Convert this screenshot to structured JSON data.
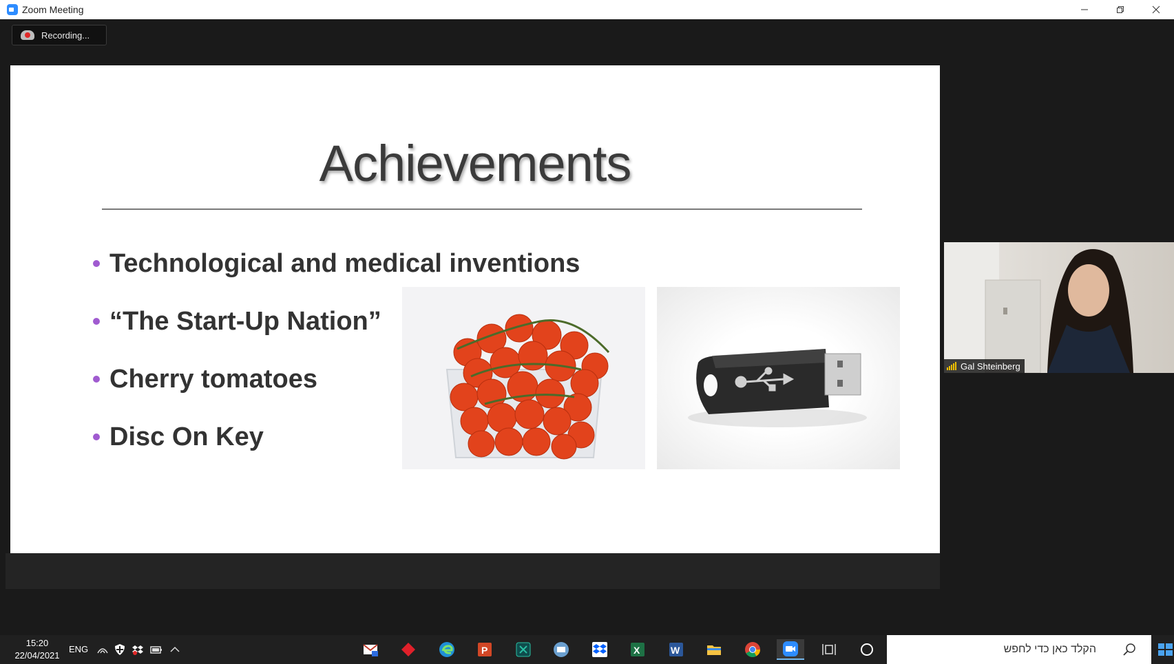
{
  "window": {
    "title": "Zoom Meeting"
  },
  "recording": {
    "label": "Recording..."
  },
  "slide": {
    "title": "Achievements",
    "bullets": [
      "Technological and medical inventions",
      "“The Start-Up Nation”",
      "Cherry tomatoes",
      "Disc On Key"
    ]
  },
  "participant": {
    "name": "Gal Shteinberg"
  },
  "taskbar": {
    "time": "15:20",
    "date": "22/04/2021",
    "language": "ENG",
    "search_placeholder": "הקלד כאן כדי לחפש",
    "apps": [
      "mail-icon",
      "antivirus-icon",
      "edge-icon",
      "powerpoint-icon",
      "app-icon",
      "tv-icon",
      "dropbox-icon",
      "excel-icon",
      "word-icon",
      "file-explorer-icon",
      "chrome-icon",
      "zoom-icon",
      "task-view-icon",
      "cortana-icon"
    ]
  },
  "colors": {
    "accent": "#a05bd0",
    "zoom_blue": "#2d8cff",
    "taskbar": "#202020"
  }
}
